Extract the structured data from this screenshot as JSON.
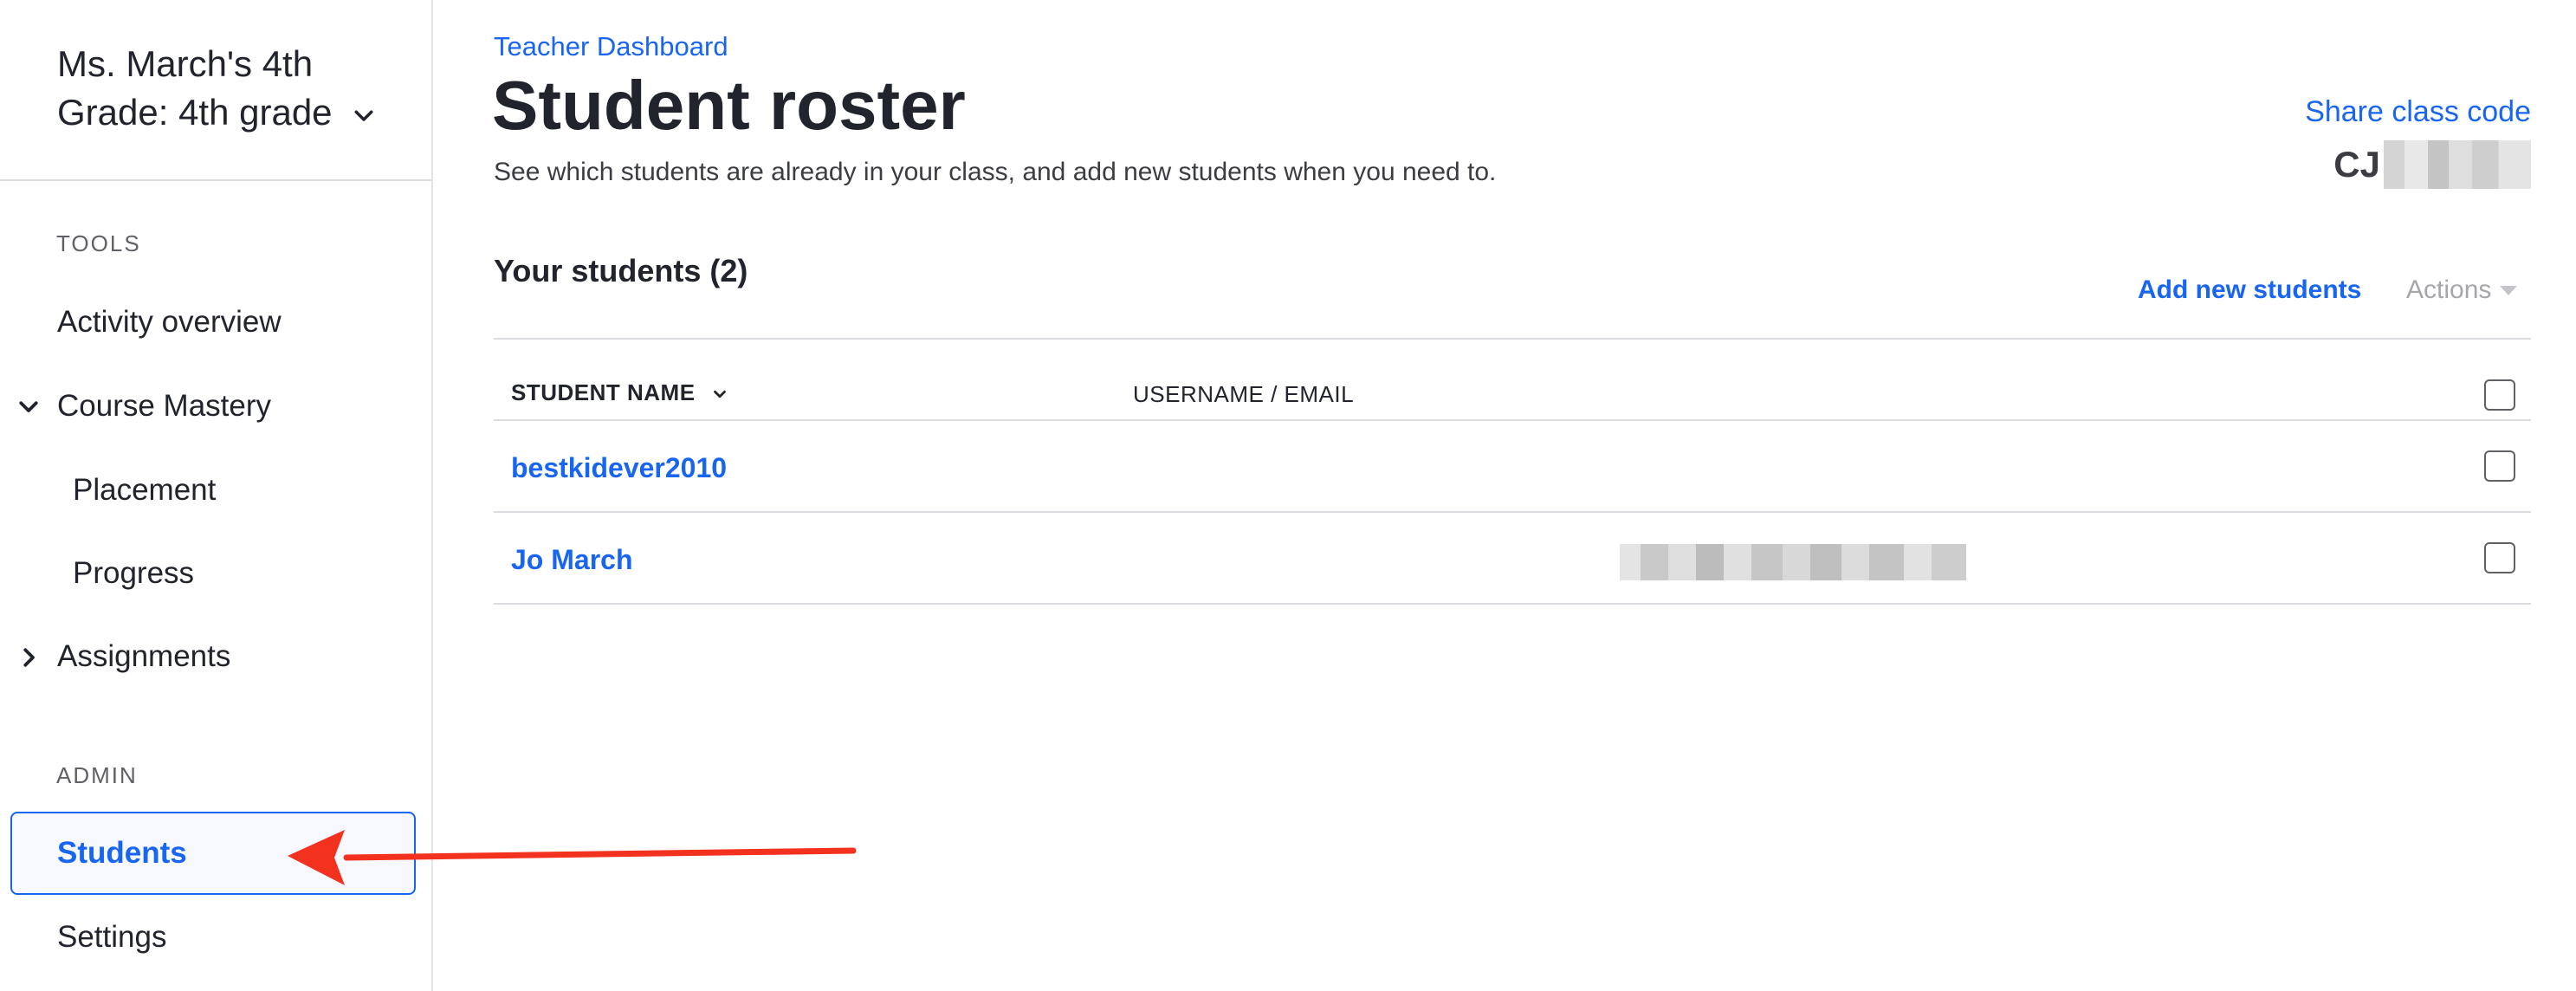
{
  "sidebar": {
    "class_name": "Ms. March's 4th Grade: 4th grade",
    "tools_label": "TOOLS",
    "admin_label": "ADMIN",
    "items": {
      "activity_overview": "Activity overview",
      "course_mastery": "Course Mastery",
      "placement": "Placement",
      "progress": "Progress",
      "assignments": "Assignments",
      "students": "Students",
      "settings": "Settings"
    }
  },
  "header": {
    "breadcrumb": "Teacher Dashboard",
    "title": "Student roster",
    "subtitle": "See which students are already in your class, and add new students when you need to.",
    "share_label": "Share class code",
    "class_code_visible": "CJ"
  },
  "roster": {
    "heading": "Your students (2)",
    "add_label": "Add new students",
    "actions_label": "Actions",
    "columns": {
      "name": "STUDENT NAME",
      "user": "USERNAME / EMAIL"
    },
    "students": [
      {
        "name": "bestkidever2010"
      },
      {
        "name": "Jo March"
      }
    ]
  },
  "colors": {
    "accent": "#1865f2",
    "annotation_arrow": "#f2311e"
  },
  "icons": {
    "class_switcher": "chevron-down-icon",
    "expanded": "chevron-down-icon",
    "collapsed": "chevron-right-icon",
    "sort": "chevron-down-icon",
    "actions": "caret-down-icon"
  }
}
